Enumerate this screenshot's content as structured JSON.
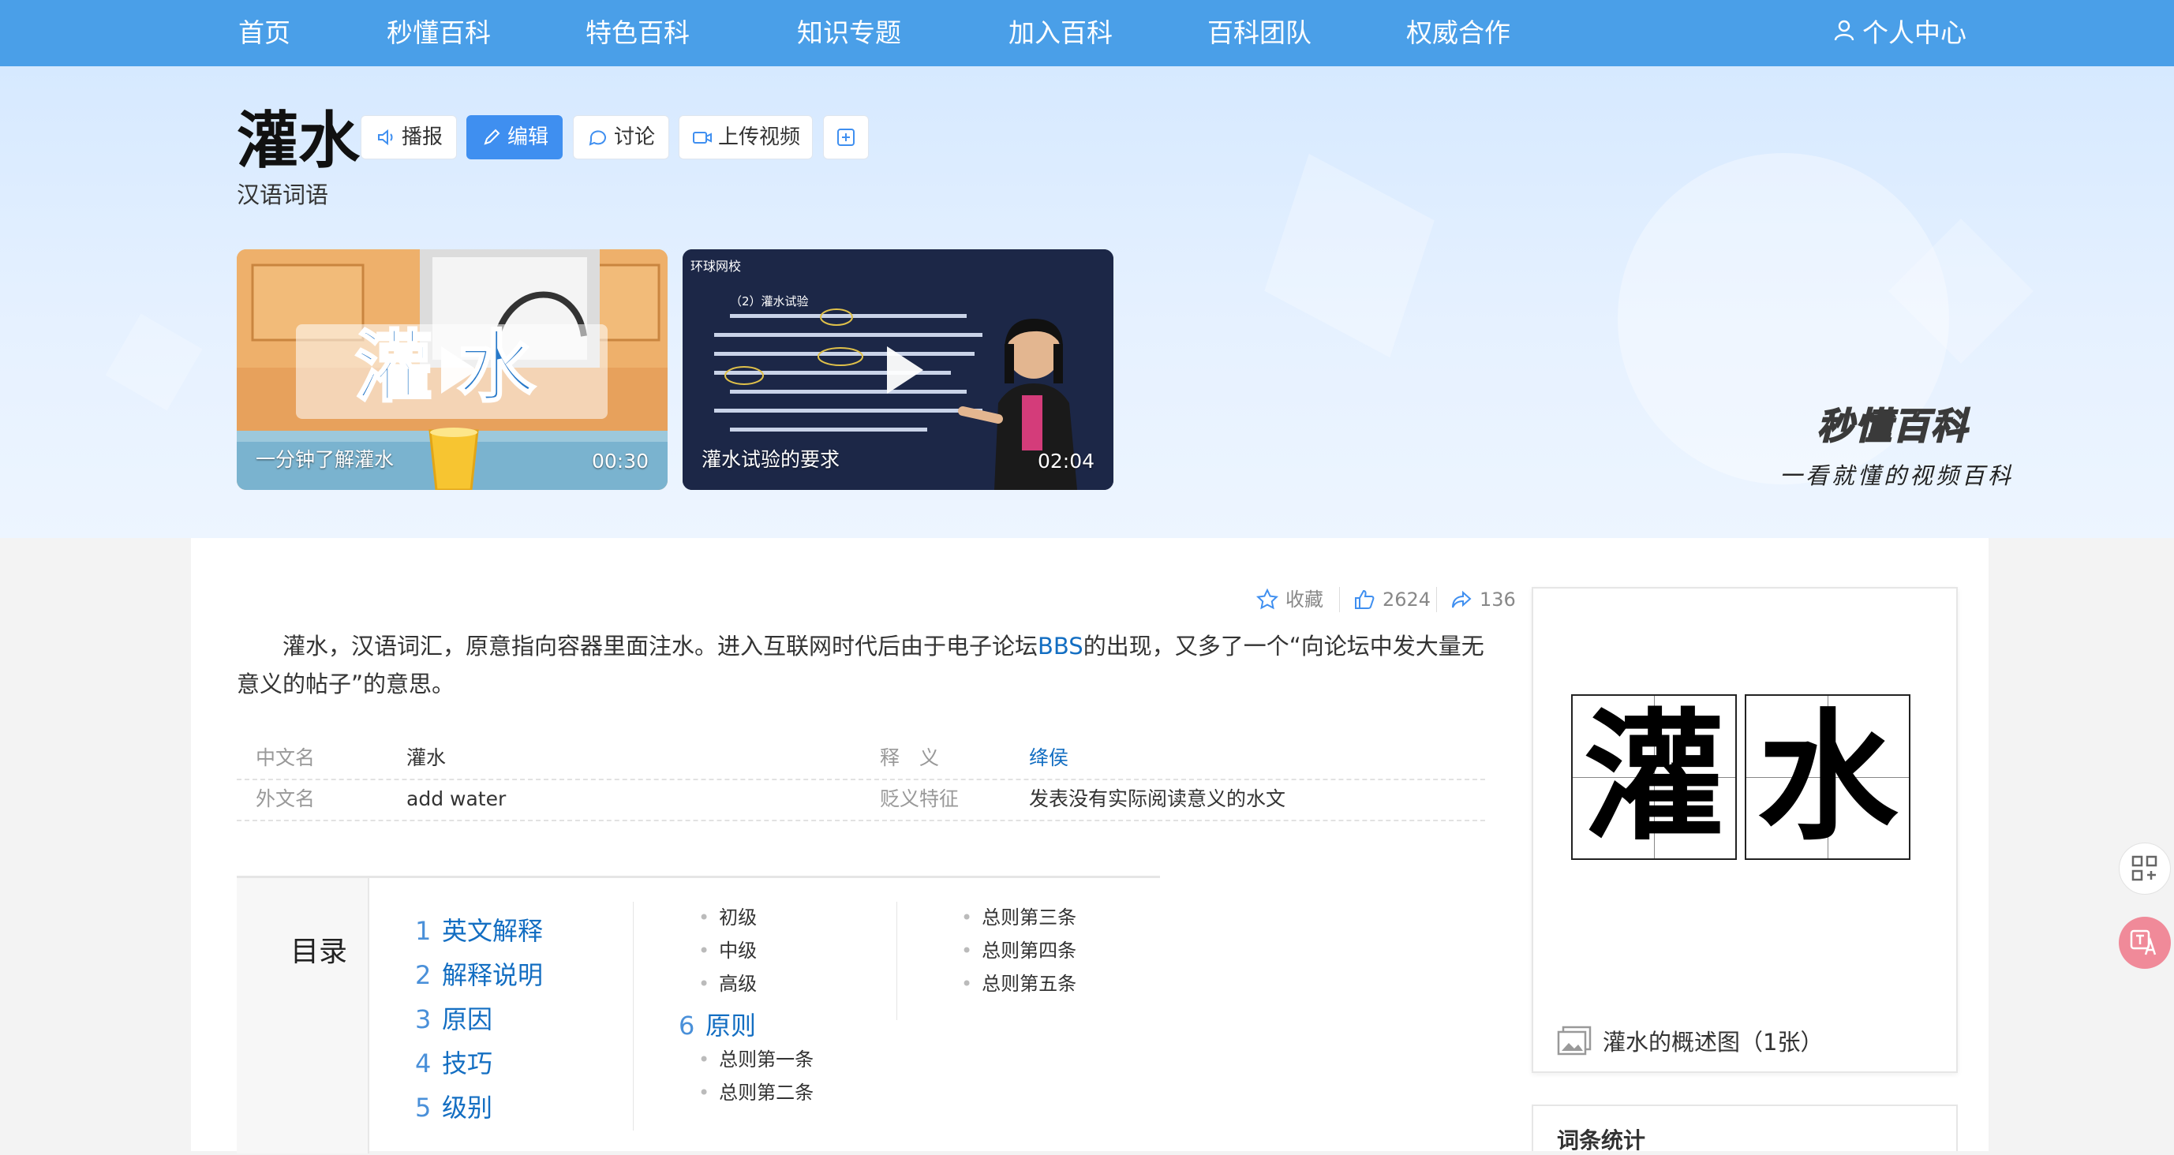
{
  "nav": {
    "items": [
      "首页",
      "秒懂百科",
      "特色百科",
      "知识专题",
      "加入百科",
      "百科团队",
      "权威合作"
    ],
    "user_label": "个人中心"
  },
  "entry": {
    "title": "灌水",
    "subtitle": "汉语词语",
    "toolbar": {
      "broadcast": "播报",
      "edit": "编辑",
      "discuss": "讨论",
      "upload_video": "上传视频"
    }
  },
  "videos": [
    {
      "title": "一分钟了解灌水",
      "duration": "00:30",
      "overlay_text": "灌水"
    },
    {
      "title": "灌水试验的要求",
      "duration": "02:04",
      "header_text": "环球网校",
      "slide_heading": "（2）灌水试验"
    }
  ],
  "brand": {
    "name": "秒懂百科",
    "slogan": "一看就懂的视频百科"
  },
  "actions": {
    "favorite": "收藏",
    "likes": "2624",
    "shares": "136"
  },
  "summary": {
    "before_link": "灌水，汉语词汇，原意指向容器里面注水。进入互联网时代后由于电子论坛",
    "link": "BBS",
    "after_link": "的出现，又多了一个“向论坛中发大量无意义的帖子”的意思。"
  },
  "infobox": [
    {
      "label": "中文名",
      "value": "灌水",
      "label2": "释　义",
      "value2": "绛侯",
      "value2_is_link": true
    },
    {
      "label": "外文名",
      "value": "add water",
      "label2": "贬义特征",
      "value2": "发表没有实际阅读意义的水文"
    }
  ],
  "catalog": {
    "heading": "目录",
    "items": [
      {
        "num": "1",
        "label": "英文解释"
      },
      {
        "num": "2",
        "label": "解释说明"
      },
      {
        "num": "3",
        "label": "原因"
      },
      {
        "num": "4",
        "label": "技巧"
      },
      {
        "num": "5",
        "label": "级别"
      },
      {
        "num": "6",
        "label": "原则"
      }
    ],
    "level_subs": [
      "初级",
      "中级",
      "高级"
    ],
    "principle_subs_a": [
      "总则第一条",
      "总则第二条"
    ],
    "principle_subs_b": [
      "总则第三条",
      "总则第四条",
      "总则第五条"
    ]
  },
  "album": {
    "chars": [
      "灌",
      "水"
    ],
    "caption": "灌水的概述图（1张）"
  },
  "stats": {
    "heading": "词条统计"
  },
  "colors": {
    "nav_bg": "#4a9fe8",
    "primary": "#3f8ff0",
    "link": "#136ec2"
  }
}
